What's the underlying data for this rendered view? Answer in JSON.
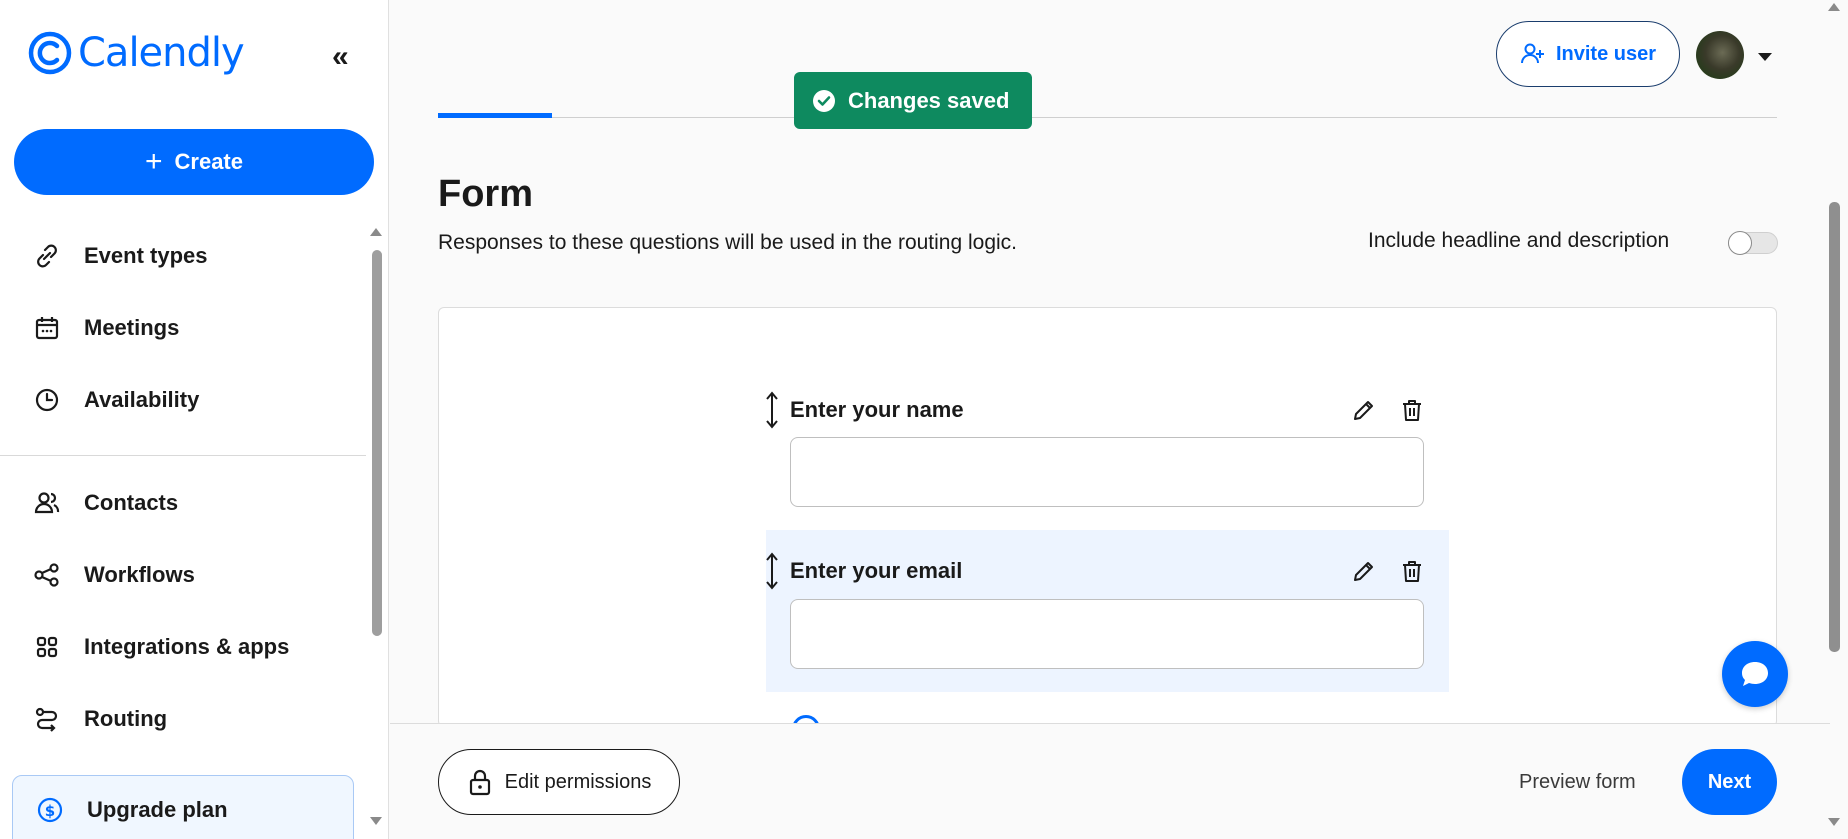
{
  "app": {
    "name": "Calendly"
  },
  "sidebar": {
    "create_label": "Create",
    "items": [
      {
        "label": "Event types",
        "icon": "link-icon"
      },
      {
        "label": "Meetings",
        "icon": "calendar-icon"
      },
      {
        "label": "Availability",
        "icon": "clock-icon"
      },
      {
        "label": "Contacts",
        "icon": "contacts-icon"
      },
      {
        "label": "Workflows",
        "icon": "workflows-icon"
      },
      {
        "label": "Integrations & apps",
        "icon": "grid-icon"
      },
      {
        "label": "Routing",
        "icon": "routing-icon"
      }
    ],
    "upgrade_label": "Upgrade plan"
  },
  "header": {
    "invite_label": "Invite user",
    "toast": "Changes saved"
  },
  "form": {
    "title": "Form",
    "description": "Responses to these questions will be used in the routing logic.",
    "include_label": "Include headline and description",
    "include_enabled": false,
    "fields": [
      {
        "label": "Enter your name",
        "value": ""
      },
      {
        "label": "Enter your email",
        "value": ""
      }
    ]
  },
  "footer": {
    "edit_permissions_label": "Edit permissions",
    "preview_label": "Preview form",
    "next_label": "Next"
  },
  "colors": {
    "brand": "#006bff",
    "toast": "#0e8a5f"
  }
}
